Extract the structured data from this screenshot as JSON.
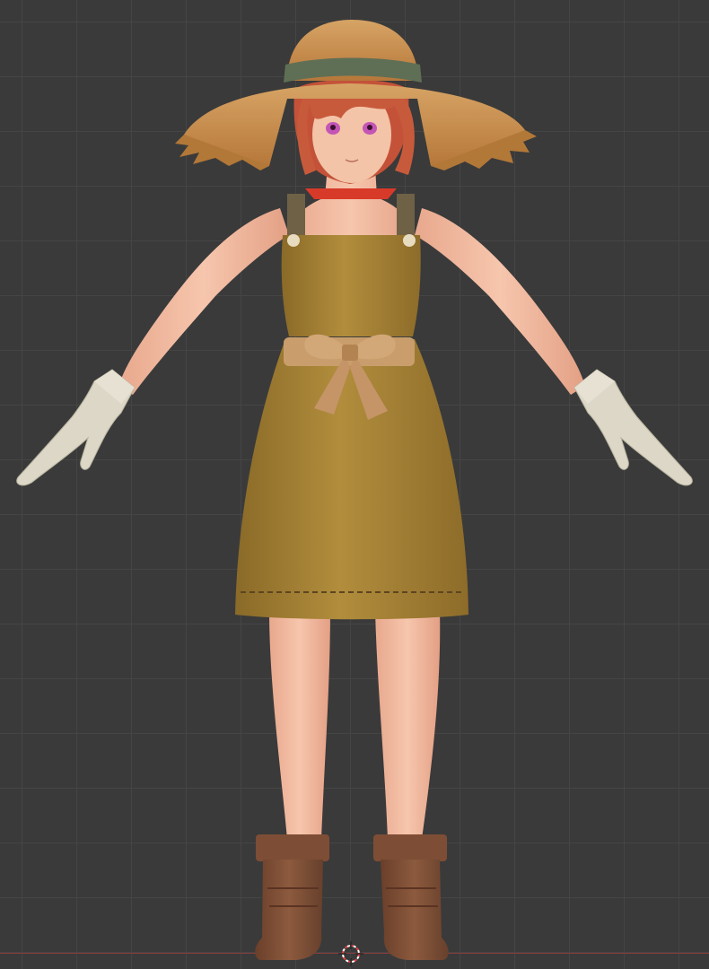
{
  "viewport": {
    "background": "#3a3a3a",
    "grid_color": "#454545",
    "x_axis_color": "#8a3b3b"
  },
  "model": {
    "pose": "T-pose",
    "hair_color": "#c8553a",
    "hat_color": "#c98e4a",
    "hat_band_color": "#5f6f55",
    "dress_color": "#a98533",
    "bow_color": "#c79a68",
    "glove_color": "#ddd8c7",
    "boot_color": "#7a4a33",
    "skin_color": "#f0b89c",
    "eye_color": "#c455b5"
  },
  "icons": {
    "cursor": "3d-cursor-icon"
  }
}
